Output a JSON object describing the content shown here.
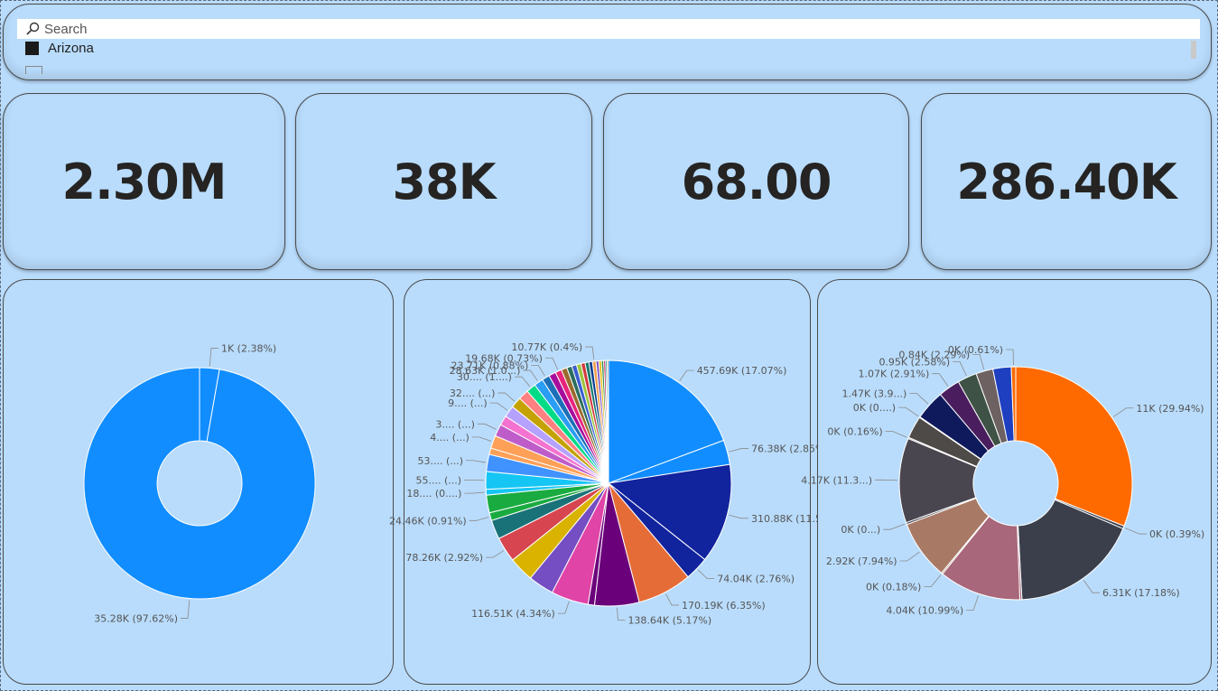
{
  "slicer": {
    "search_placeholder": "Search",
    "items": [
      {
        "label": "Arizona",
        "checked": true
      }
    ]
  },
  "kpis": [
    {
      "value": "2.30M"
    },
    {
      "value": "38K"
    },
    {
      "value": "68.00"
    },
    {
      "value": "286.40K"
    }
  ],
  "chart_data": [
    {
      "type": "pie",
      "donut": true,
      "slices": [
        {
          "value": 1,
          "label": "1K (2.38%)",
          "color": "#118dff"
        },
        {
          "value": 35.28,
          "label": "35.28K (97.62%)",
          "color": "#118dff"
        }
      ]
    },
    {
      "type": "pie",
      "donut": false,
      "slices": [
        {
          "value": 457.69,
          "label": "457.69K (17.07%)",
          "color": "#118dff"
        },
        {
          "value": 76.38,
          "label": "76.38K (2.85%)",
          "color": "#118dff"
        },
        {
          "value": 310.88,
          "label": "310.88K (11.5...)",
          "color": "#12239e"
        },
        {
          "value": 74.04,
          "label": "74.04K (2.76%)",
          "color": "#12239e"
        },
        {
          "value": 170.19,
          "label": "170.19K (6.35%)",
          "color": "#e66c37"
        },
        {
          "value": 138.64,
          "label": "138.64K (5.17%)",
          "color": "#6b007b"
        },
        {
          "value": 20,
          "label": "",
          "color": "#6b007b"
        },
        {
          "value": 116.51,
          "label": "116.51K (4.34%)",
          "color": "#e044a7"
        },
        {
          "value": 80,
          "label": "",
          "color": "#744ec2"
        },
        {
          "value": 78,
          "label": "",
          "color": "#d9b300"
        },
        {
          "value": 78.26,
          "label": "78.26K (2.92%)",
          "color": "#d64550"
        },
        {
          "value": 60,
          "label": "",
          "color": "#197278"
        },
        {
          "value": 24.46,
          "label": "24.46K (0.91%)",
          "color": "#1aab40"
        },
        {
          "value": 55,
          "label": "",
          "color": "#1aab40"
        },
        {
          "value": 18,
          "label": "18.... (0....)",
          "color": "#15c6f4"
        },
        {
          "value": 55,
          "label": "55.... (...)",
          "color": "#15c6f4"
        },
        {
          "value": 53,
          "label": "53.... (...)",
          "color": "#4092ff"
        },
        {
          "value": 20,
          "label": "",
          "color": "#ffa058"
        },
        {
          "value": 40,
          "label": "4.... (...)",
          "color": "#ffa058"
        },
        {
          "value": 38,
          "label": "3.... (...)",
          "color": "#be5dc9"
        },
        {
          "value": 30,
          "label": "",
          "color": "#f472d0"
        },
        {
          "value": 36,
          "label": "9.... (...)",
          "color": "#b5a1ff"
        },
        {
          "value": 34,
          "label": "32.... (...)",
          "color": "#c4a200"
        },
        {
          "value": 32,
          "label": "",
          "color": "#ff8080"
        },
        {
          "value": 30,
          "label": "30.... (1....)",
          "color": "#00db87"
        },
        {
          "value": 28.63,
          "label": "28.63K (1.0...)",
          "color": "#2a9df4"
        },
        {
          "value": 23.71,
          "label": "23.71K (0.88%)",
          "color": "#1d6fb8"
        },
        {
          "value": 22,
          "label": "",
          "color": "#a60d9c"
        },
        {
          "value": 19.68,
          "label": "19.68K (0.73%)",
          "color": "#e8247b"
        },
        {
          "value": 18,
          "label": "",
          "color": "#9a6b2d"
        },
        {
          "value": 16,
          "label": "",
          "color": "#2a6e5b"
        },
        {
          "value": 15,
          "label": "",
          "color": "#3b5fd0"
        },
        {
          "value": 14,
          "label": "",
          "color": "#9bc53d"
        },
        {
          "value": 13,
          "label": "",
          "color": "#d13b40"
        },
        {
          "value": 12,
          "label": "",
          "color": "#19796b"
        },
        {
          "value": 11,
          "label": "",
          "color": "#0b3d91"
        },
        {
          "value": 10.77,
          "label": "10.77K (0.4%)",
          "color": "#f29e4c"
        },
        {
          "value": 9,
          "label": "",
          "color": "#7e57c2"
        },
        {
          "value": 8,
          "label": "",
          "color": "#e6b800"
        },
        {
          "value": 7,
          "label": "",
          "color": "#2b8a3e"
        },
        {
          "value": 6,
          "label": "",
          "color": "#c2185b"
        },
        {
          "value": 5,
          "label": "",
          "color": "#00897b"
        },
        {
          "value": 4,
          "label": "",
          "color": "#5d4037"
        }
      ]
    },
    {
      "type": "pie",
      "donut": true,
      "slices": [
        {
          "value": 11,
          "label": "11K (29.94%)",
          "color": "#ff6a00"
        },
        {
          "value": 0.14,
          "label": "0K (0.39%)",
          "color": "#3b3f4c"
        },
        {
          "value": 6.31,
          "label": "6.31K (17.18%)",
          "color": "#3b3f4c"
        },
        {
          "value": 0.1,
          "label": "",
          "color": "#a8677a"
        },
        {
          "value": 4.04,
          "label": "4.04K (10.99%)",
          "color": "#a8677a"
        },
        {
          "value": 0.07,
          "label": "0K (0.18%)",
          "color": "#a87a66"
        },
        {
          "value": 2.92,
          "label": "2.92K (7.94%)",
          "color": "#a87a66"
        },
        {
          "value": 0.1,
          "label": "0K (0...)",
          "color": "#4a4650"
        },
        {
          "value": 4.17,
          "label": "4.17K (11.3...)",
          "color": "#4a4650"
        },
        {
          "value": 0.06,
          "label": "0K (0.16%)",
          "color": "#4a4650"
        },
        {
          "value": 1.1,
          "label": "",
          "color": "#4d4a48"
        },
        {
          "value": 0.04,
          "label": "0K (0....)",
          "color": "#0f1a5c"
        },
        {
          "value": 1.47,
          "label": "1.47K (3.9...)",
          "color": "#0f1a5c"
        },
        {
          "value": 1.07,
          "label": "1.07K (2.91%)",
          "color": "#4a1e5e"
        },
        {
          "value": 0.95,
          "label": "0.95K (2.58%)",
          "color": "#3e5245"
        },
        {
          "value": 0.84,
          "label": "0.84K (2.29%)",
          "color": "#6e6162"
        },
        {
          "value": 0.9,
          "label": "",
          "color": "#1e3fbf"
        },
        {
          "value": 0.22,
          "label": "0K (0.61%)",
          "color": "#ff6a00"
        }
      ]
    }
  ]
}
